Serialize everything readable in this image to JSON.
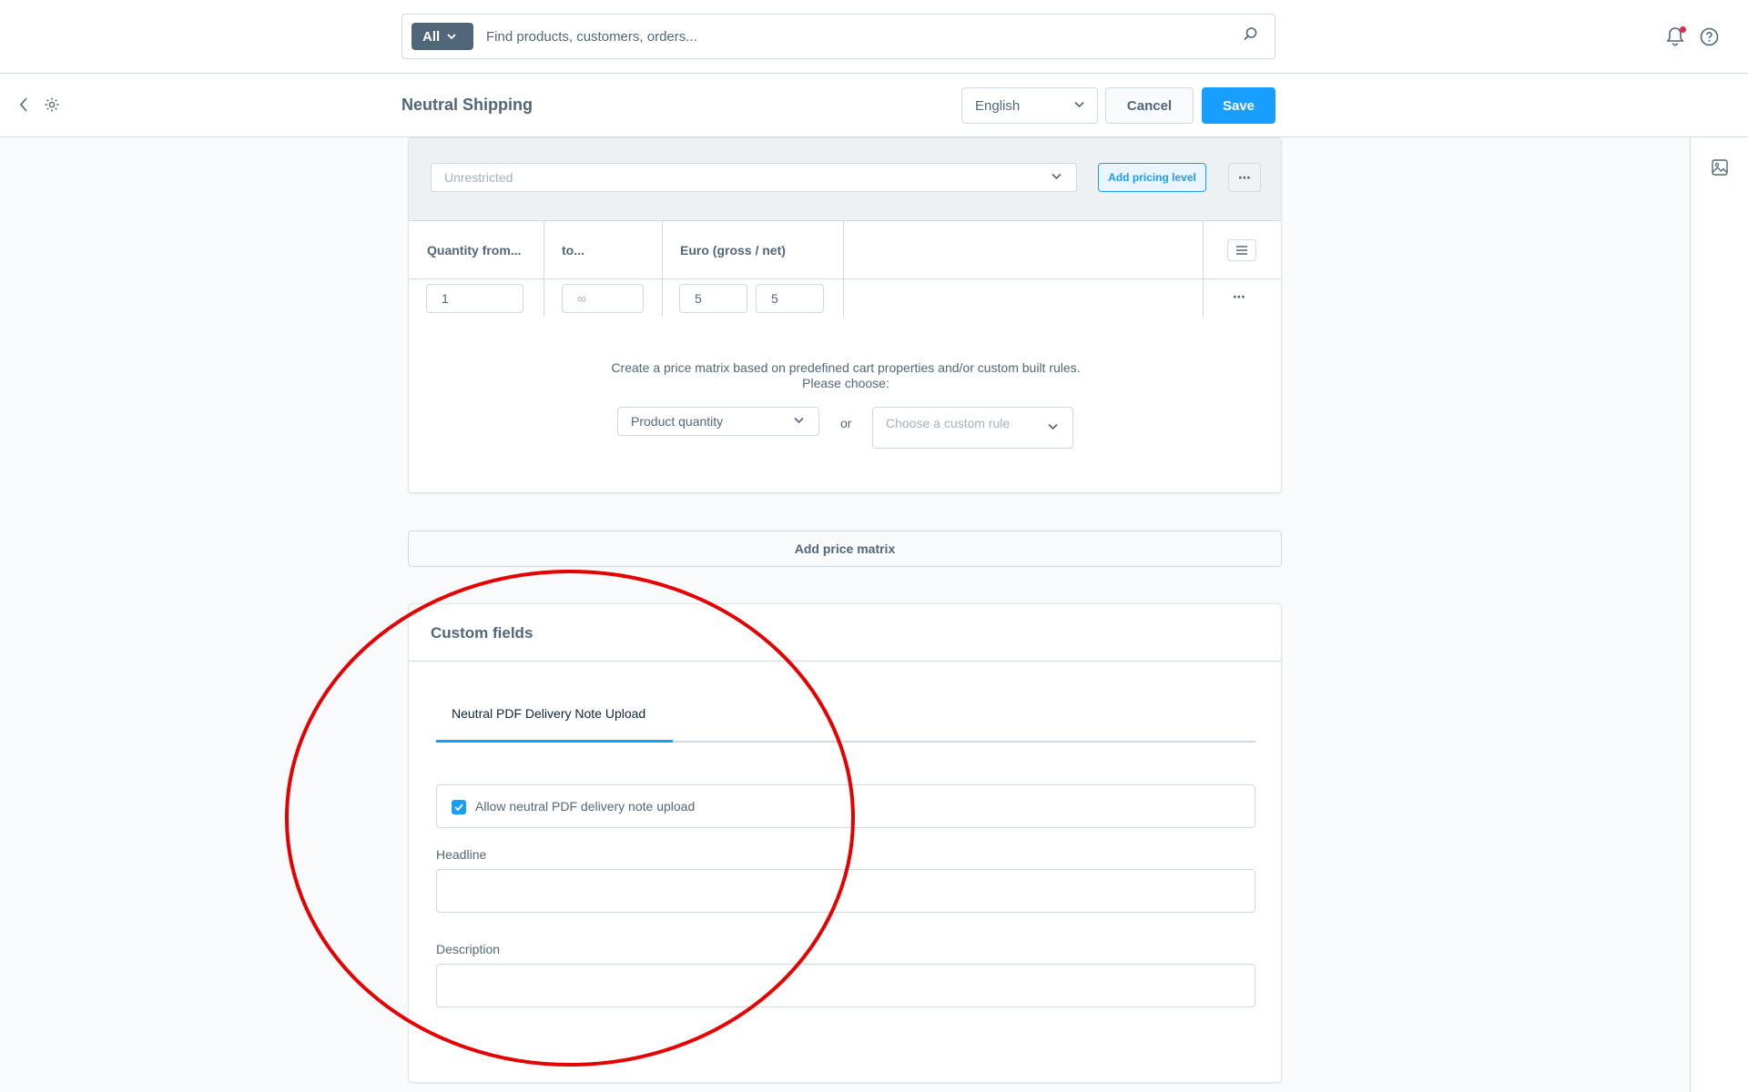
{
  "search": {
    "scope": "All",
    "placeholder": "Find products, customers, orders..."
  },
  "header": {
    "title": "Neutral Shipping",
    "language": "English",
    "cancel_label": "Cancel",
    "save_label": "Save"
  },
  "pricing": {
    "rule": "Unrestricted",
    "add_pricing_level": "Add pricing level",
    "more": "⋯",
    "columns": [
      "Quantity from...",
      "to...",
      "Euro (gross / net)"
    ],
    "row": {
      "quantity_from": "1",
      "quantity_to": "∞",
      "gross": "5",
      "net": "5",
      "more": "⋯"
    },
    "matrix_text": "Create a price matrix based on predefined cart properties and/or custom built rules. Please choose:",
    "property_select": "Product quantity",
    "or_label": "or",
    "custom_rule_placeholder": "Choose a custom rule",
    "add_matrix": "Add price matrix"
  },
  "custom_fields": {
    "title": "Custom fields",
    "tab": "Neutral PDF Delivery Note Upload",
    "checkbox_label": "Allow neutral PDF delivery note upload",
    "checkbox_checked": true,
    "headline_label": "Headline",
    "headline_value": "",
    "description_label": "Description",
    "description_value": ""
  },
  "colors": {
    "accent": "#189eff",
    "annotation": "#e60000",
    "notification_dot": "#de294c"
  },
  "icons": [
    "search-icon",
    "chevron-down-icon",
    "bell-icon",
    "help-icon",
    "back-icon",
    "settings-icon",
    "image-icon",
    "list-icon",
    "check-icon"
  ]
}
